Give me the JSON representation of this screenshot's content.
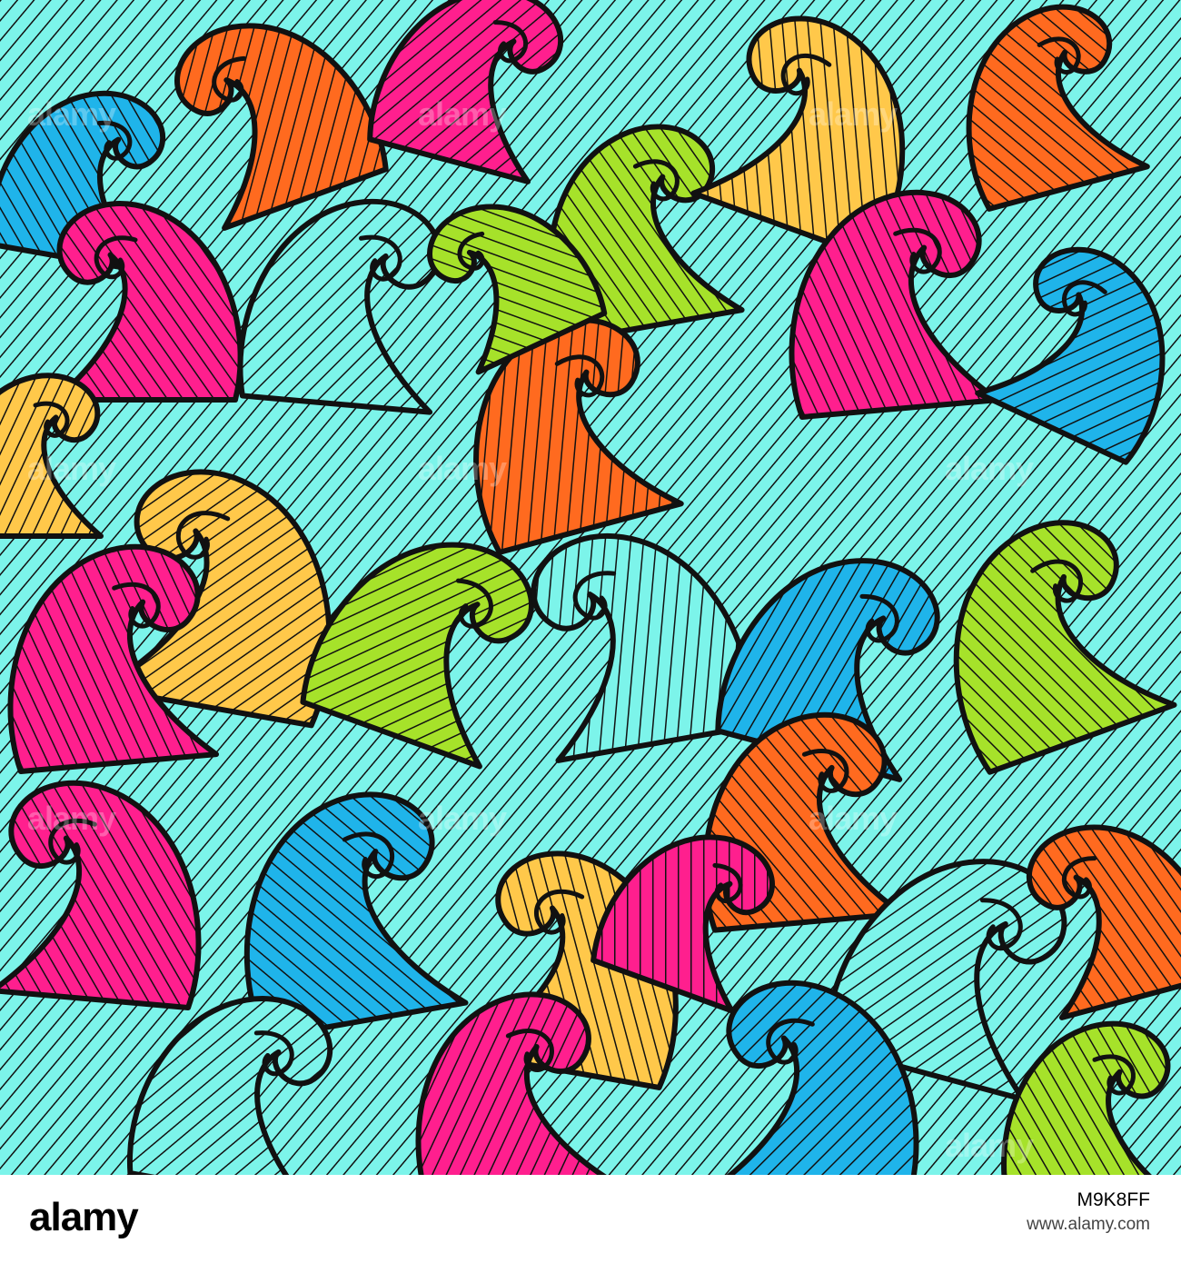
{
  "artwork": {
    "style": "seamless colorful doodle wave swirl pattern",
    "watermark": "alamy",
    "palette": {
      "pink": "#ff1f8e",
      "orange": "#ff6a1f",
      "yellow": "#ffc84a",
      "lime": "#a6e22a",
      "cyan": "#7cf4ea",
      "blue": "#1fb4ea",
      "outline": "#111111"
    }
  },
  "footer": {
    "logo": "alamy",
    "image_id": "M9K8FF",
    "site": "www.alamy.com"
  }
}
